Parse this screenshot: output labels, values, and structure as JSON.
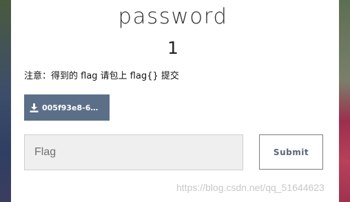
{
  "challenge": {
    "name": "password",
    "value": "1",
    "notice": "注意：得到的 flag 请包上 flag{} 提交"
  },
  "download": {
    "label": "005f93e8-6…",
    "icon": "download-icon"
  },
  "form": {
    "flag_placeholder": "Flag",
    "submit_label": "Submit"
  },
  "watermark": "https://blog.csdn.net/qq_51644623",
  "colors": {
    "download_bg": "#5b6f88",
    "input_bg": "#efefef"
  }
}
